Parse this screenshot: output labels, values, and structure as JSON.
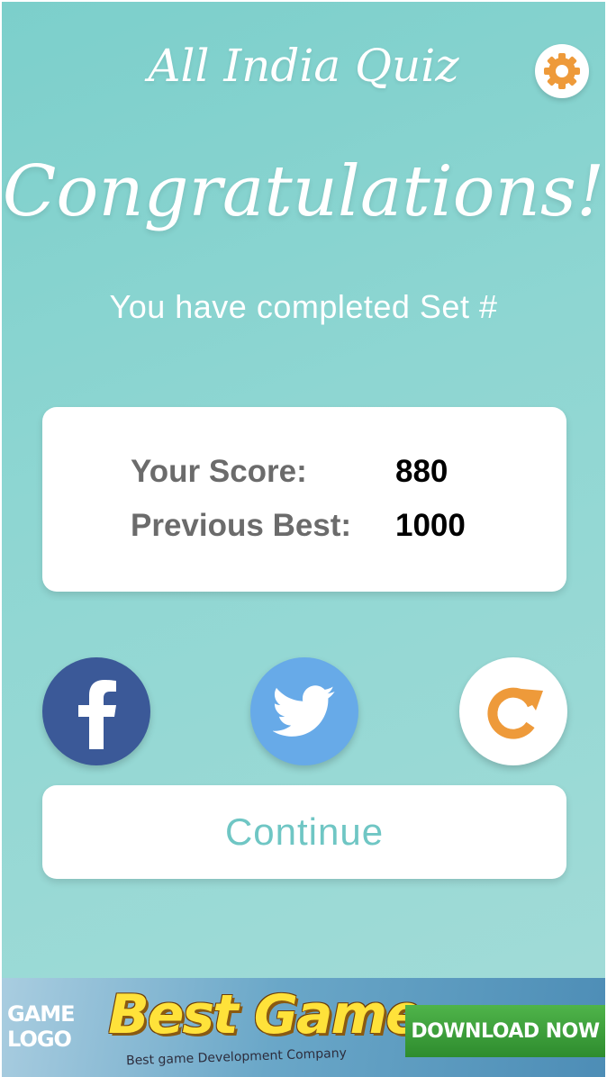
{
  "header": {
    "app_title": "All India Quiz",
    "settings_icon": "gear-icon"
  },
  "main": {
    "headline": "Congratulations!",
    "subtitle": "You have completed Set #",
    "score_card": {
      "score_label": "Your Score:",
      "score_value": "880",
      "best_label": "Previous Best:",
      "best_value": "1000"
    },
    "share": {
      "facebook_icon": "facebook-icon",
      "twitter_icon": "twitter-icon",
      "replay_icon": "replay-icon"
    },
    "continue_label": "Continue"
  },
  "ad": {
    "logo_line1": "GAME",
    "logo_line2": "LOGO",
    "title": "Best Game",
    "tagline": "Best game Development Company",
    "cta": "DOWNLOAD NOW"
  },
  "colors": {
    "background": "#8ed6d2",
    "accent_orange": "#ee9a3a",
    "facebook_blue": "#3b5998",
    "twitter_blue": "#67aae8",
    "continue_text": "#6fc6c4"
  }
}
